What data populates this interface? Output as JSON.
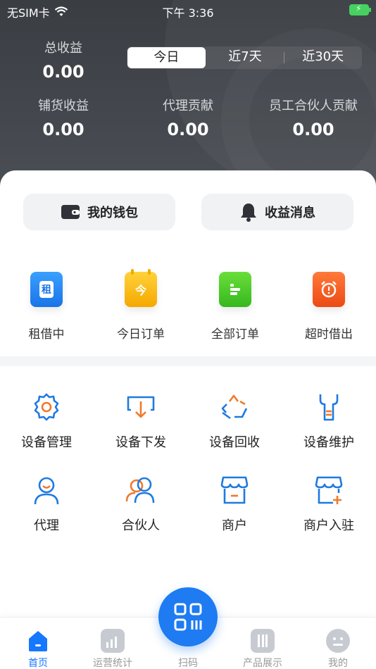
{
  "status_bar": {
    "carrier": "无SIM卡",
    "time": "下午 3:36"
  },
  "earnings": {
    "total_label": "总收益",
    "total_value": "0.00",
    "tabs": [
      "今日",
      "近7天",
      "近30天"
    ],
    "active_tab": "今日",
    "stock_label": "铺货收益",
    "stock_value": "0.00",
    "agent_label": "代理贡献",
    "agent_value": "0.00",
    "staff_label": "员工合伙人贡献",
    "staff_value": "0.00"
  },
  "actions": {
    "wallet": "我的钱包",
    "messages": "收益消息"
  },
  "orders": [
    {
      "label": "租借中",
      "icon": "rent-icon",
      "glyph": "租",
      "color": "#2a8bf2"
    },
    {
      "label": "今日订单",
      "icon": "calendar-icon",
      "glyph": "今",
      "color": "#f7b500"
    },
    {
      "label": "全部订单",
      "icon": "list-icon",
      "glyph": "",
      "color": "#45c92a"
    },
    {
      "label": "超时借出",
      "icon": "alarm-icon",
      "glyph": "",
      "color": "#f05a1e"
    }
  ],
  "functions": [
    {
      "label": "设备管理",
      "icon": "gear-icon"
    },
    {
      "label": "设备下发",
      "icon": "download-icon"
    },
    {
      "label": "设备回收",
      "icon": "recycle-icon"
    },
    {
      "label": "设备维护",
      "icon": "wrench-icon"
    },
    {
      "label": "代理",
      "icon": "agent-icon"
    },
    {
      "label": "合伙人",
      "icon": "partners-icon"
    },
    {
      "label": "商户",
      "icon": "store-icon"
    },
    {
      "label": "商户入驻",
      "icon": "store-add-icon"
    }
  ],
  "tabbar": {
    "items": [
      "首页",
      "运营统计",
      "扫码",
      "产品展示",
      "我的"
    ],
    "active": "首页",
    "accent": "#1677ff"
  }
}
